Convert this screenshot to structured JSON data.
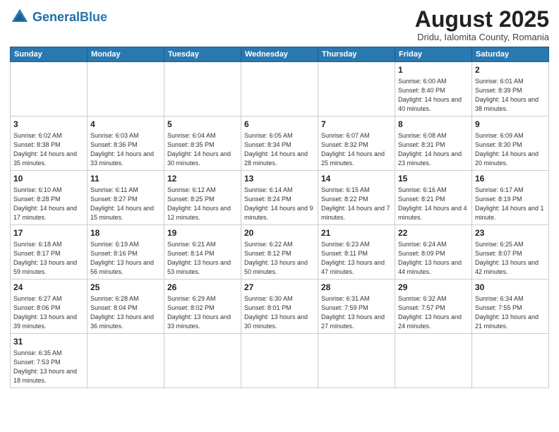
{
  "header": {
    "logo_general": "General",
    "logo_blue": "Blue",
    "main_title": "August 2025",
    "subtitle": "Dridu, Ialomita County, Romania"
  },
  "weekdays": [
    "Sunday",
    "Monday",
    "Tuesday",
    "Wednesday",
    "Thursday",
    "Friday",
    "Saturday"
  ],
  "days": [
    {
      "num": "",
      "info": ""
    },
    {
      "num": "",
      "info": ""
    },
    {
      "num": "",
      "info": ""
    },
    {
      "num": "",
      "info": ""
    },
    {
      "num": "",
      "info": ""
    },
    {
      "num": "1",
      "info": "Sunrise: 6:00 AM\nSunset: 8:40 PM\nDaylight: 14 hours\nand 40 minutes."
    },
    {
      "num": "2",
      "info": "Sunrise: 6:01 AM\nSunset: 8:39 PM\nDaylight: 14 hours\nand 38 minutes."
    },
    {
      "num": "3",
      "info": "Sunrise: 6:02 AM\nSunset: 8:38 PM\nDaylight: 14 hours\nand 35 minutes."
    },
    {
      "num": "4",
      "info": "Sunrise: 6:03 AM\nSunset: 8:36 PM\nDaylight: 14 hours\nand 33 minutes."
    },
    {
      "num": "5",
      "info": "Sunrise: 6:04 AM\nSunset: 8:35 PM\nDaylight: 14 hours\nand 30 minutes."
    },
    {
      "num": "6",
      "info": "Sunrise: 6:05 AM\nSunset: 8:34 PM\nDaylight: 14 hours\nand 28 minutes."
    },
    {
      "num": "7",
      "info": "Sunrise: 6:07 AM\nSunset: 8:32 PM\nDaylight: 14 hours\nand 25 minutes."
    },
    {
      "num": "8",
      "info": "Sunrise: 6:08 AM\nSunset: 8:31 PM\nDaylight: 14 hours\nand 23 minutes."
    },
    {
      "num": "9",
      "info": "Sunrise: 6:09 AM\nSunset: 8:30 PM\nDaylight: 14 hours\nand 20 minutes."
    },
    {
      "num": "10",
      "info": "Sunrise: 6:10 AM\nSunset: 8:28 PM\nDaylight: 14 hours\nand 17 minutes."
    },
    {
      "num": "11",
      "info": "Sunrise: 6:11 AM\nSunset: 8:27 PM\nDaylight: 14 hours\nand 15 minutes."
    },
    {
      "num": "12",
      "info": "Sunrise: 6:12 AM\nSunset: 8:25 PM\nDaylight: 14 hours\nand 12 minutes."
    },
    {
      "num": "13",
      "info": "Sunrise: 6:14 AM\nSunset: 8:24 PM\nDaylight: 14 hours\nand 9 minutes."
    },
    {
      "num": "14",
      "info": "Sunrise: 6:15 AM\nSunset: 8:22 PM\nDaylight: 14 hours\nand 7 minutes."
    },
    {
      "num": "15",
      "info": "Sunrise: 6:16 AM\nSunset: 8:21 PM\nDaylight: 14 hours\nand 4 minutes."
    },
    {
      "num": "16",
      "info": "Sunrise: 6:17 AM\nSunset: 8:19 PM\nDaylight: 14 hours\nand 1 minute."
    },
    {
      "num": "17",
      "info": "Sunrise: 6:18 AM\nSunset: 8:17 PM\nDaylight: 13 hours\nand 59 minutes."
    },
    {
      "num": "18",
      "info": "Sunrise: 6:19 AM\nSunset: 8:16 PM\nDaylight: 13 hours\nand 56 minutes."
    },
    {
      "num": "19",
      "info": "Sunrise: 6:21 AM\nSunset: 8:14 PM\nDaylight: 13 hours\nand 53 minutes."
    },
    {
      "num": "20",
      "info": "Sunrise: 6:22 AM\nSunset: 8:12 PM\nDaylight: 13 hours\nand 50 minutes."
    },
    {
      "num": "21",
      "info": "Sunrise: 6:23 AM\nSunset: 8:11 PM\nDaylight: 13 hours\nand 47 minutes."
    },
    {
      "num": "22",
      "info": "Sunrise: 6:24 AM\nSunset: 8:09 PM\nDaylight: 13 hours\nand 44 minutes."
    },
    {
      "num": "23",
      "info": "Sunrise: 6:25 AM\nSunset: 8:07 PM\nDaylight: 13 hours\nand 42 minutes."
    },
    {
      "num": "24",
      "info": "Sunrise: 6:27 AM\nSunset: 8:06 PM\nDaylight: 13 hours\nand 39 minutes."
    },
    {
      "num": "25",
      "info": "Sunrise: 6:28 AM\nSunset: 8:04 PM\nDaylight: 13 hours\nand 36 minutes."
    },
    {
      "num": "26",
      "info": "Sunrise: 6:29 AM\nSunset: 8:02 PM\nDaylight: 13 hours\nand 33 minutes."
    },
    {
      "num": "27",
      "info": "Sunrise: 6:30 AM\nSunset: 8:01 PM\nDaylight: 13 hours\nand 30 minutes."
    },
    {
      "num": "28",
      "info": "Sunrise: 6:31 AM\nSunset: 7:59 PM\nDaylight: 13 hours\nand 27 minutes."
    },
    {
      "num": "29",
      "info": "Sunrise: 6:32 AM\nSunset: 7:57 PM\nDaylight: 13 hours\nand 24 minutes."
    },
    {
      "num": "30",
      "info": "Sunrise: 6:34 AM\nSunset: 7:55 PM\nDaylight: 13 hours\nand 21 minutes."
    },
    {
      "num": "31",
      "info": "Sunrise: 6:35 AM\nSunset: 7:53 PM\nDaylight: 13 hours\nand 18 minutes."
    }
  ]
}
